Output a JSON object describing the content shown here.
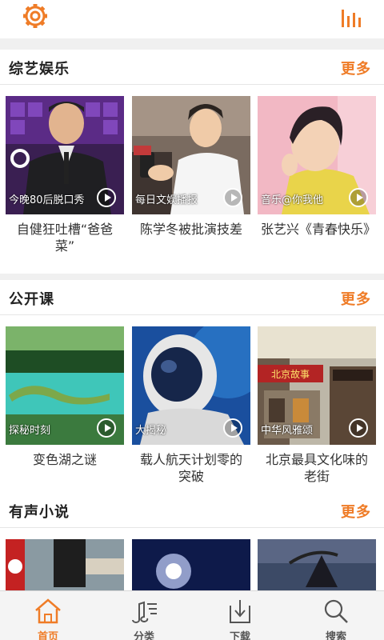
{
  "header": {
    "settings_icon": "gear-icon",
    "menu_icon": "equalizer-icon",
    "accent": "#ef7c27"
  },
  "sections": [
    {
      "title": "综艺娱乐",
      "more": "更多",
      "items": [
        {
          "tag": "今晚80后脱口秀",
          "caption": "自健狂吐槽“爸爸菜”"
        },
        {
          "tag": "每日文娱播报",
          "caption": "陈学冬被批演技差"
        },
        {
          "tag": "音乐@你我他",
          "caption": "张艺兴《青春快乐》"
        }
      ]
    },
    {
      "title": "公开课",
      "more": "更多",
      "items": [
        {
          "tag": "探秘时刻",
          "caption": "变色湖之谜"
        },
        {
          "tag": "大揭秘",
          "caption": "载人航天计划零的突破"
        },
        {
          "tag": "中华风雅颂",
          "caption": "北京最具文化味的老街"
        }
      ]
    },
    {
      "title": "有声小说",
      "more": "更多",
      "items": [
        {
          "tag": "",
          "caption": ""
        },
        {
          "tag": "",
          "caption": ""
        },
        {
          "tag": "",
          "caption": ""
        }
      ]
    }
  ],
  "shop_sign": "北京故事",
  "tabs": [
    {
      "label": "首页",
      "icon": "home-icon",
      "active": true
    },
    {
      "label": "分类",
      "icon": "music-list-icon",
      "active": false
    },
    {
      "label": "下载",
      "icon": "download-icon",
      "active": false
    },
    {
      "label": "搜索",
      "icon": "search-icon",
      "active": false
    }
  ]
}
